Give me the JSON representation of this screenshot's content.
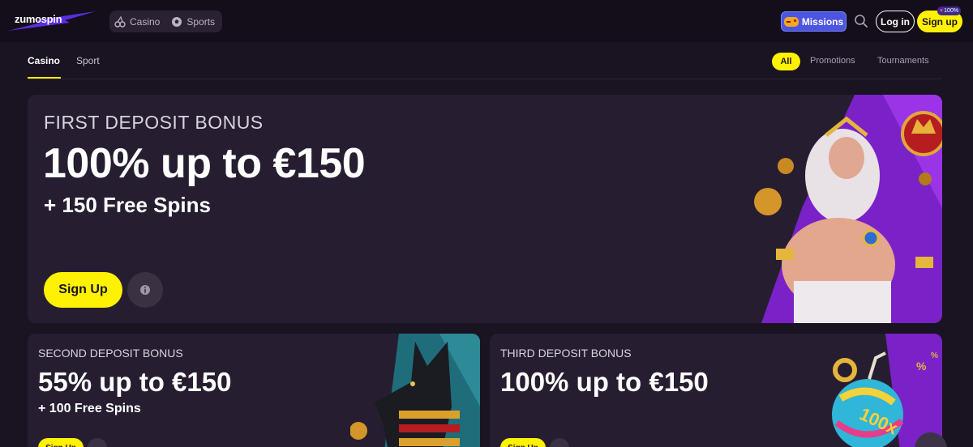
{
  "header": {
    "logo": "zumospin",
    "verticals": [
      {
        "label": "Casino",
        "icon": "cherries-icon"
      },
      {
        "label": "Sports",
        "icon": "soccer-ball-icon"
      }
    ],
    "missions_label": "Missions",
    "login_label": "Log in",
    "signup_label": "Sign up",
    "signup_badge": "100%"
  },
  "subnav": {
    "tabs": [
      {
        "label": "Casino",
        "active": true
      },
      {
        "label": "Sport",
        "active": false
      }
    ],
    "filters": [
      {
        "label": "All",
        "active": true
      },
      {
        "label": "Promotions",
        "active": false
      },
      {
        "label": "Tournaments",
        "active": false
      }
    ]
  },
  "hero": {
    "subtitle": "FIRST DEPOSIT BONUS",
    "title": "100% up to €150",
    "extra": "+ 150 Free Spins",
    "cta": "Sign Up",
    "info_icon": "info-icon"
  },
  "cards": [
    {
      "subtitle": "SECOND DEPOSIT BONUS",
      "title": "55% up to €150",
      "extra": "+ 100 Free Spins",
      "cta": "Sign Up"
    },
    {
      "subtitle": "THIRD DEPOSIT BONUS",
      "title": "100% up to €150",
      "extra": "",
      "cta": "Sign Up"
    }
  ],
  "colors": {
    "background": "#1a1322",
    "card": "#261e30",
    "accent": "#fff200",
    "missions": "#4b55e0"
  }
}
